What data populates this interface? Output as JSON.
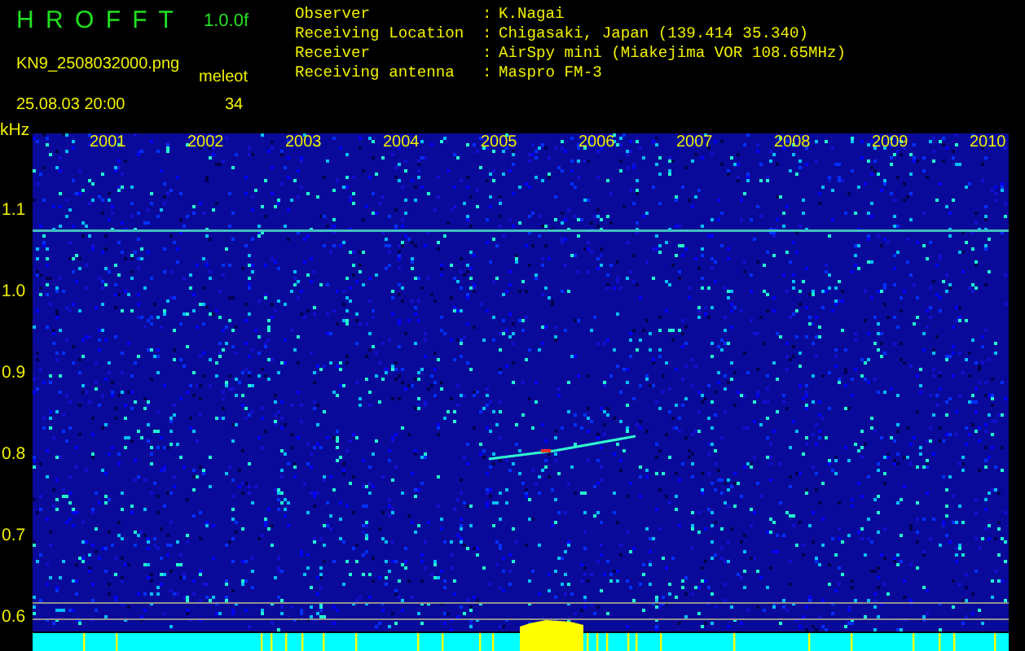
{
  "header": {
    "title": "H R O F F T",
    "version": "1.0.0f",
    "filename": "KN9_2508032000.png",
    "datetime": "25.08.03 20:00",
    "detection_label": "meleot",
    "count": "34"
  },
  "info": [
    {
      "label": "Observer",
      "separator": ":",
      "value": "K.Nagai"
    },
    {
      "label": "Receiving Location",
      "separator": ":",
      "value": "Chigasaki, Japan (139.414 35.340)"
    },
    {
      "label": "Receiver",
      "separator": ":",
      "value": "AirSpy mini (Miakejima VOR 108.65MHz)"
    },
    {
      "label": "Receiving antenna",
      "separator": ":",
      "value": "Maspro FM-3"
    }
  ],
  "axis": {
    "unit": "kHz",
    "y_labels": [
      "1.1",
      "1.0",
      "0.9",
      "0.8",
      "0.7",
      "0.6"
    ],
    "time_labels": [
      "2001",
      "2002",
      "2003",
      "2004",
      "2005",
      "2006",
      "2007",
      "2008",
      "2009",
      "2010"
    ]
  }
}
